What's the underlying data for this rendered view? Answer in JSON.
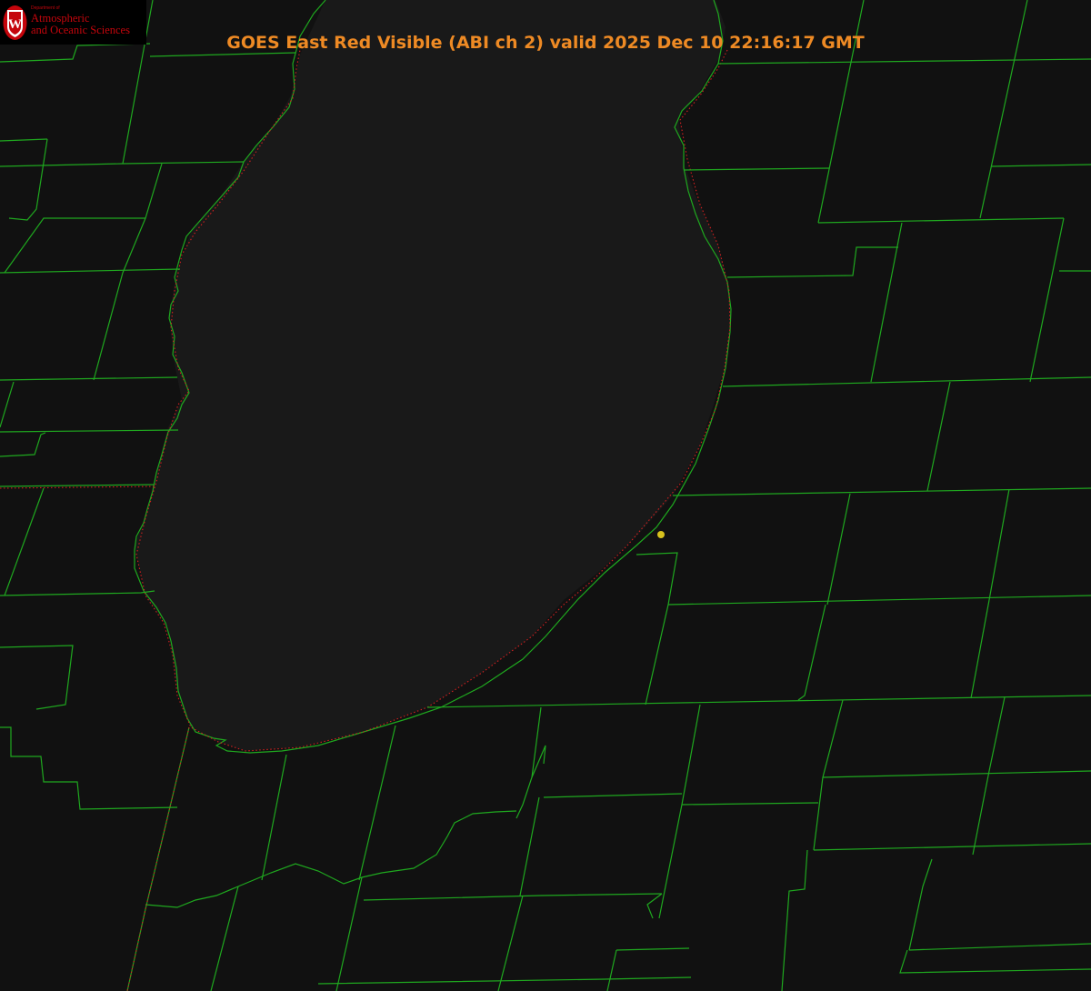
{
  "logo": {
    "department": "Department of",
    "line1": "Atmospheric",
    "line2": "and Oceanic Sciences",
    "seal_letter": "W"
  },
  "title": "GOES East Red Visible (ABI ch 2) valid 2025 Dec 10 22:16:17 GMT",
  "colors": {
    "background": "#111111",
    "lake": "#191919",
    "county_lines": "#1fa81f",
    "shoreline_dots": "#d42020",
    "marker": "#d8c21e",
    "title": "#ee8a24",
    "logo_red": "#c5050c"
  }
}
